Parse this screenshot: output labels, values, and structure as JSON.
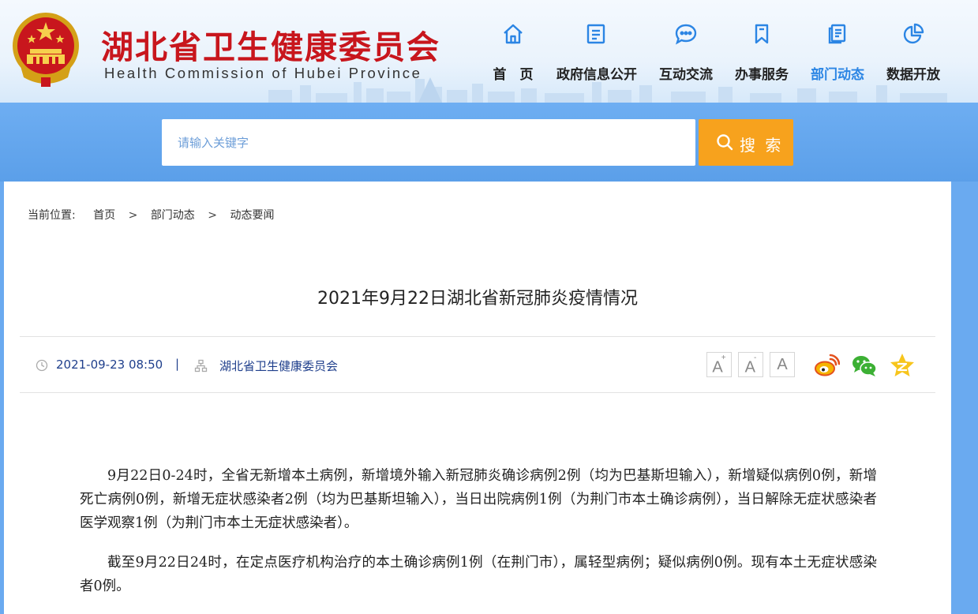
{
  "header": {
    "title_cn": "湖北省卫生健康委员会",
    "title_en": "Health Commission of Hubei Province"
  },
  "nav": {
    "items": [
      {
        "label": "首　页",
        "icon": "home-icon"
      },
      {
        "label": "政府信息公开",
        "icon": "document-icon"
      },
      {
        "label": "互动交流",
        "icon": "chat-icon"
      },
      {
        "label": "办事服务",
        "icon": "bookmark-icon"
      },
      {
        "label": "部门动态",
        "icon": "news-icon",
        "active": true
      },
      {
        "label": "数据开放",
        "icon": "pie-chart-icon"
      }
    ],
    "active_color": "#2b85e4"
  },
  "search": {
    "placeholder": "请输入关键字",
    "button_label": "搜 索",
    "button_color": "#f7a21d"
  },
  "breadcrumb": {
    "label": "当前位置:",
    "items": [
      "首页",
      "部门动态",
      "动态要闻"
    ],
    "separator": ">"
  },
  "article": {
    "title": "2021年9月22日湖北省新冠肺炎疫情情况",
    "date": "2021-09-23 08:50",
    "divider": "|",
    "source": "湖北省卫生健康委员会",
    "paragraphs": [
      "9月22日0-24时，全省无新增本土病例，新增境外输入新冠肺炎确诊病例2例（均为巴基斯坦输入），新增疑似病例0例，新增死亡病例0例，新增无症状感染者2例（均为巴基斯坦输入），当日出院病例1例（为荆门市本土确诊病例），当日解除无症状感染者医学观察1例（为荆门市本土无症状感染者）。",
      "截至9月22日24时，在定点医疗机构治疗的本土确诊病例1例（在荆门市），属轻型病例；疑似病例0例。现有本土无症状感染者0例。"
    ]
  },
  "font_controls": {
    "larger": "A",
    "larger_mark": "+",
    "smaller": "A",
    "smaller_mark": "-",
    "default": "A"
  },
  "share_icons": [
    "weibo-icon",
    "wechat-icon",
    "qzone-icon"
  ]
}
